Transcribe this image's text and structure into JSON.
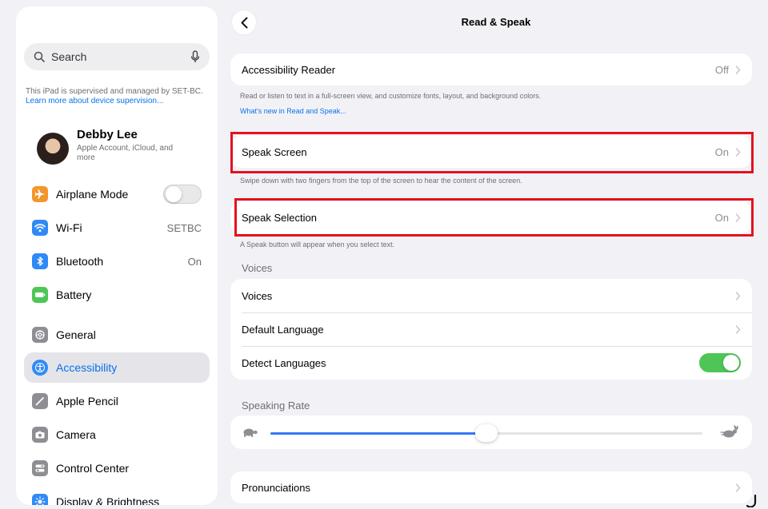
{
  "sidebar": {
    "search_placeholder": "Search",
    "supervision_text": "This iPad is supervised and managed by SET-BC. ",
    "supervision_link": "Learn more about device supervision...",
    "profile": {
      "name": "Debby Lee",
      "subtitle": "Apple Account, iCloud, and more"
    },
    "items": [
      {
        "label": "Airplane Mode",
        "icon": "airplane-icon",
        "color": "#f3962c",
        "toggle": "off"
      },
      {
        "label": "Wi-Fi",
        "icon": "wifi-icon",
        "color": "#2f8af5",
        "value": "SETBC"
      },
      {
        "label": "Bluetooth",
        "icon": "bluetooth-icon",
        "color": "#2f8af5",
        "value": "On"
      },
      {
        "label": "Battery",
        "icon": "battery-icon",
        "color": "#4fc557"
      },
      {
        "label": "General",
        "icon": "gear-icon",
        "color": "#8e8e93"
      },
      {
        "label": "Accessibility",
        "icon": "accessibility-icon",
        "color": "#2f8af5",
        "active": true
      },
      {
        "label": "Apple Pencil",
        "icon": "pencil-icon",
        "color": "#8e8e93"
      },
      {
        "label": "Camera",
        "icon": "camera-icon",
        "color": "#8e8e93"
      },
      {
        "label": "Control Center",
        "icon": "control-center-icon",
        "color": "#8e8e93"
      },
      {
        "label": "Display & Brightness",
        "icon": "sun-icon",
        "color": "#2f8af5"
      }
    ]
  },
  "header": {
    "title": "Read & Speak"
  },
  "main": {
    "accessibility_reader": {
      "label": "Accessibility Reader",
      "value": "Off",
      "footnote": "Read or listen to text in a full-screen view, and customize fonts, layout, and background colors.",
      "link": "What's new in Read and Speak..."
    },
    "speak_screen": {
      "label": "Speak Screen",
      "value": "On",
      "footnote": "Swipe down with two fingers from the top of the screen to hear the content of the screen."
    },
    "speak_selection": {
      "label": "Speak Selection",
      "value": "On",
      "footnote": "A Speak button will appear when you select text."
    },
    "voices_section": {
      "header": "Voices",
      "voices_label": "Voices",
      "default_language_label": "Default Language",
      "detect_languages_label": "Detect Languages",
      "detect_languages_on": true
    },
    "speaking_rate": {
      "header": "Speaking Rate",
      "value_fraction": 0.5
    },
    "pronunciations_label": "Pronunciations"
  },
  "colors": {
    "accent": "#0a72e8",
    "highlight": "#e3131e",
    "toggle_on": "#4fc557"
  }
}
